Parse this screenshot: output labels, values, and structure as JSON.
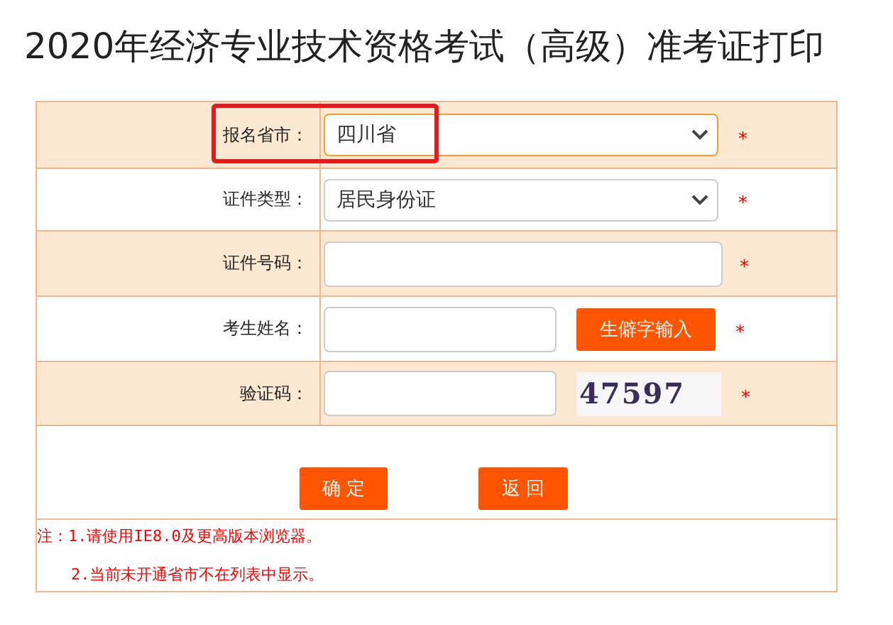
{
  "title": "2020年经济专业技术资格考试（高级）准考证打印",
  "rows": [
    {
      "kind": "select",
      "label": "报名省市：",
      "value": "四川省",
      "focused": true,
      "highlighted": true,
      "required": "*"
    },
    {
      "kind": "select",
      "label": "证件类型：",
      "value": "居民身份证",
      "focused": false,
      "highlighted": false,
      "required": "*"
    },
    {
      "kind": "input",
      "label": "证件号码：",
      "required": "*"
    },
    {
      "kind": "input_button",
      "label": "考生姓名：",
      "button": "生僻字输入",
      "required": "*"
    },
    {
      "kind": "captcha",
      "label": "验证码：",
      "captcha": "47597",
      "required": "*"
    }
  ],
  "buttons": [
    "确 定",
    "返 回"
  ],
  "notes": [
    "注：1.请使用IE8.0及更高版本浏览器。",
    "2.当前未开通省市不在列表中显示。"
  ]
}
